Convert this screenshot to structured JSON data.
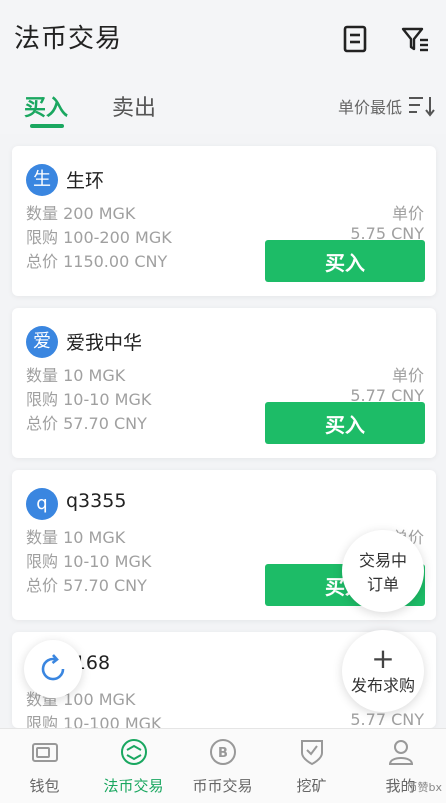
{
  "header": {
    "title": "法币交易"
  },
  "tabs": {
    "buy": "买入",
    "sell": "卖出",
    "sort": "单价最低"
  },
  "orders": [
    {
      "avatar": "生",
      "name": "生环",
      "quantity": "数量 200 MGK",
      "limit": "限购 100-200 MGK",
      "total": "总价 1150.00 CNY",
      "price_label": "单价",
      "price": "5.75 CNY",
      "button": "买入"
    },
    {
      "avatar": "爱",
      "name": "爱我中华",
      "quantity": "数量 10 MGK",
      "limit": "限购 10-10 MGK",
      "total": "总价 57.70 CNY",
      "price_label": "单价",
      "price": "5.77 CNY",
      "button": "买入"
    },
    {
      "avatar": "q",
      "name": "q3355",
      "quantity": "数量 10 MGK",
      "limit": "限购 10-10 MGK",
      "total": "总价 57.70 CNY",
      "price_label": "单价",
      "price": "",
      "button": "买入"
    },
    {
      "avatar": "",
      "name": "r168",
      "quantity": "数量 100 MGK",
      "limit": "限购 10-100 MGK",
      "total": "",
      "price_label": "",
      "price": "5.77 CNY",
      "button": ""
    }
  ],
  "floating": {
    "trading_line1": "交易中",
    "trading_line2": "订单",
    "publish_plus": "+",
    "publish_label": "发布求购"
  },
  "nav": {
    "wallet": "钱包",
    "fiat": "法币交易",
    "coin": "币币交易",
    "mining": "挖矿",
    "mine": "我的"
  },
  "watermark": "币赞bx",
  "colors": {
    "accent": "#1aa760",
    "button": "#1dbc67",
    "avatar": "#3a86e0"
  }
}
